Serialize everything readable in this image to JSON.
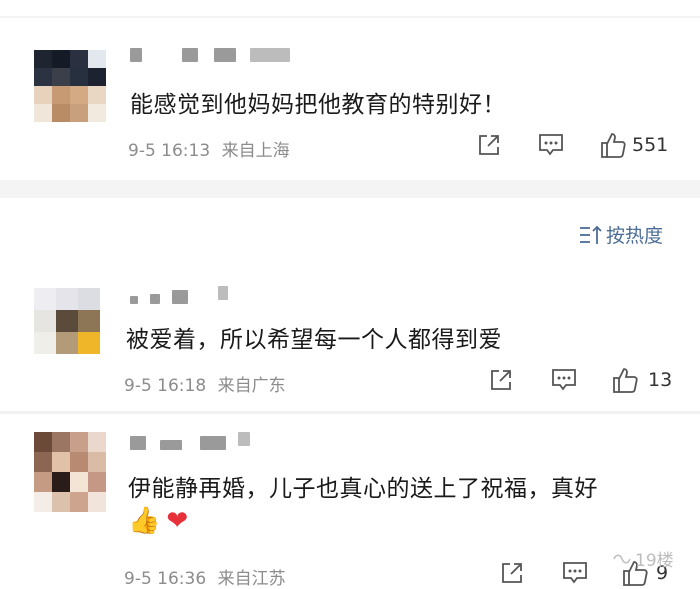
{
  "sort": {
    "label": "按热度"
  },
  "comments": [
    {
      "text": "能感觉到他妈妈把他教育的特别好！",
      "time": "9-5 16:13",
      "location": "来自上海",
      "likes": "551",
      "emojis": []
    },
    {
      "text": "被爱着，所以希望每一个人都得到爱",
      "time": "9-5 16:18",
      "location": "来自广东",
      "likes": "13",
      "emojis": []
    },
    {
      "text": "伊能静再婚，儿子也真心的送上了祝福，真好",
      "time": "9-5 16:36",
      "location": "来自江苏",
      "likes": "9",
      "emojis": [
        "👍",
        "❤"
      ]
    }
  ],
  "watermark": {
    "text": "19楼"
  },
  "icons": {
    "share": "share-icon",
    "comment": "comment-icon",
    "like": "thumbs-up-icon",
    "sort": "sort-icon"
  },
  "colors": {
    "link": "#4b6d95",
    "meta": "#8c8c8c",
    "heart": "#e6303a"
  }
}
